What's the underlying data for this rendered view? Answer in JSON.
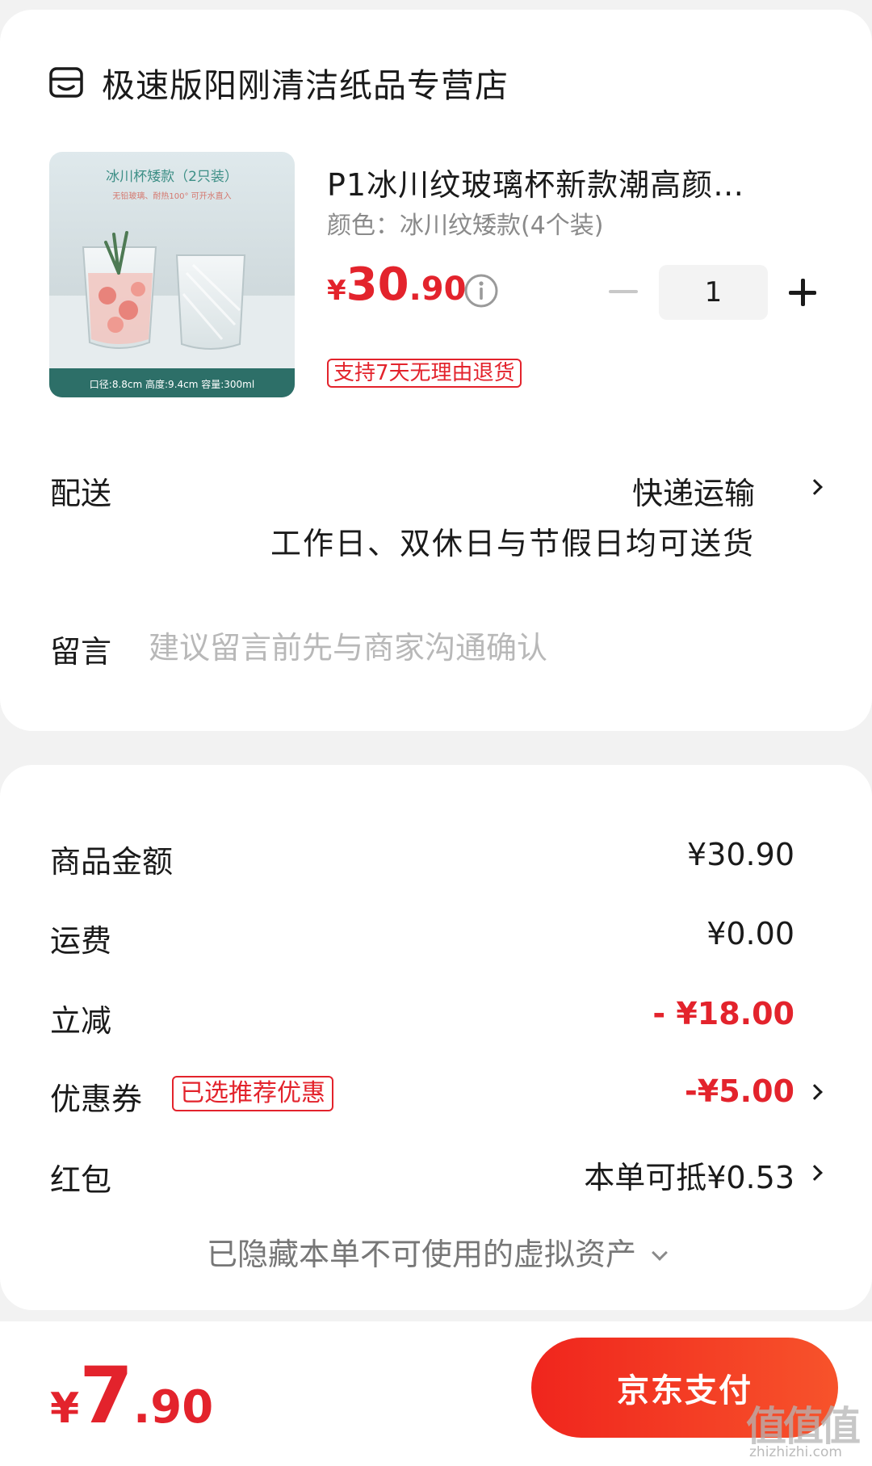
{
  "store": {
    "name": "极速版阳刚清洁纸品专营店",
    "icon": "store-icon"
  },
  "product": {
    "title": "P1冰川纹玻璃杯新款潮高颜…",
    "spec": "颜色：冰川纹矮款(4个装)",
    "price": {
      "currency": "¥",
      "integer": "30",
      "decimal": ".90"
    },
    "quantity": "1",
    "return_tag": "支持7天无理由退货",
    "image": {
      "banner": "冰川杯矮款（2只装）",
      "sub": "无铅玻璃、耐热100°  可开水直入",
      "footer": "口径:8.8cm   高度:9.4cm   容量:300ml"
    }
  },
  "delivery": {
    "label": "配送",
    "method": "快递运输",
    "note": "工作日、双休日与节假日均可送货"
  },
  "message": {
    "label": "留言",
    "placeholder": "建议留言前先与商家沟通确认"
  },
  "summary": {
    "goods_amount": {
      "label": "商品金额",
      "value": "¥30.90"
    },
    "shipping": {
      "label": "运费",
      "value": "¥0.00"
    },
    "instant_discount": {
      "label": "立减",
      "value": "- ¥18.00"
    },
    "coupon": {
      "label": "优惠券",
      "tag": "已选推荐优惠",
      "value": "-¥5.00"
    },
    "red_packet": {
      "label": "红包",
      "value": "本单可抵¥0.53"
    },
    "hidden_assets": "已隐藏本单不可使用的虚拟资产"
  },
  "footer": {
    "total": {
      "currency": "¥",
      "integer": "7",
      "decimal": ".90"
    },
    "pay_label": "京东支付",
    "watermark": "值值值",
    "watermark_url": "zhizhizhi.com"
  },
  "colors": {
    "accent": "#e3232c",
    "pay_gradient_start": "#f0251d",
    "pay_gradient_end": "#f7532b"
  }
}
